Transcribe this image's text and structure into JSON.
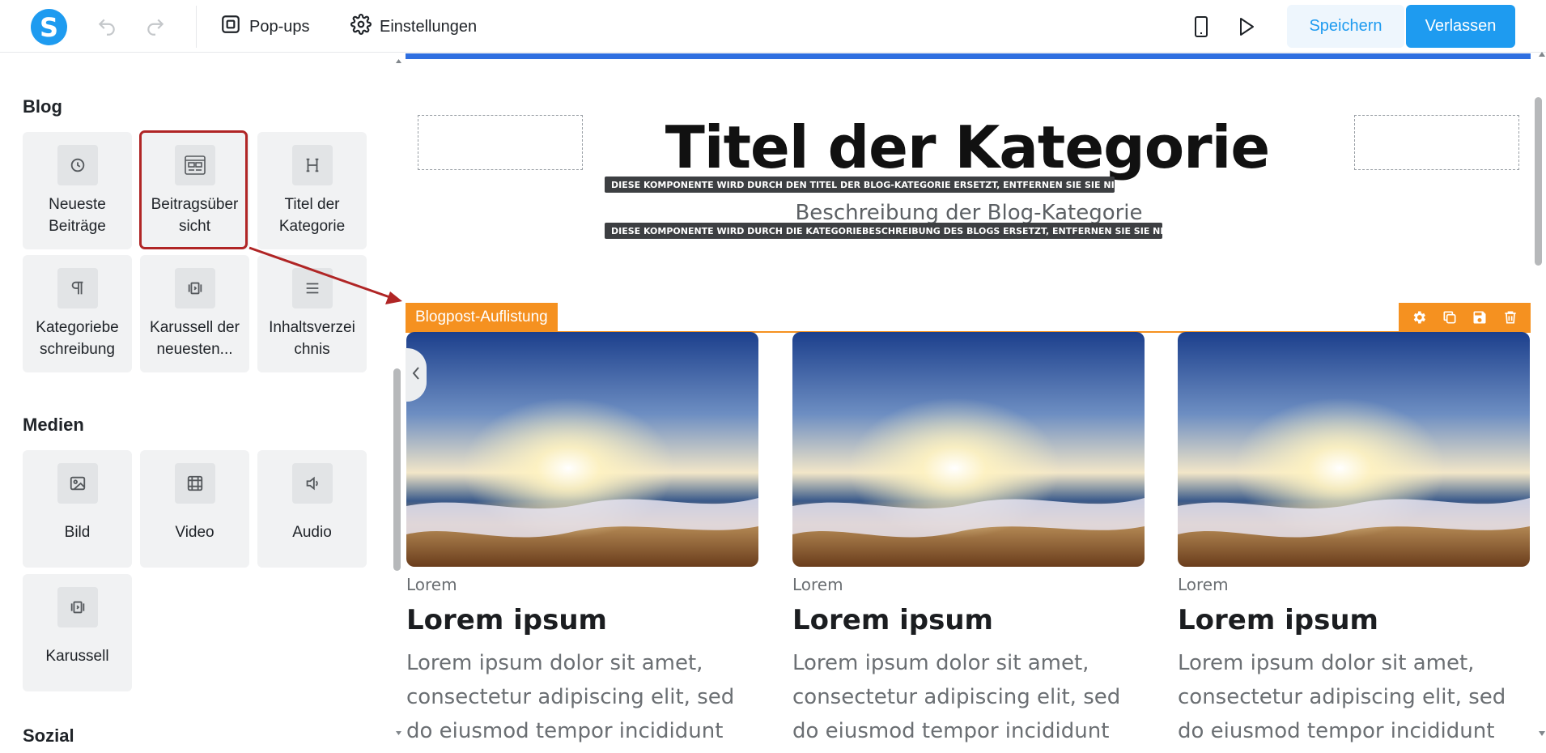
{
  "app": {
    "logo_letter": "S"
  },
  "toolbar": {
    "popups_label": "Pop-ups",
    "settings_label": "Einstellungen",
    "save_label": "Speichern",
    "exit_label": "Verlassen"
  },
  "sidebar": {
    "sections": [
      {
        "title": "Blog",
        "items": [
          {
            "label": "Neueste Beiträge",
            "icon": "clock-icon"
          },
          {
            "label": "Beitragsübersicht",
            "icon": "layout-icon"
          },
          {
            "label": "Titel der Kategorie",
            "icon": "heading-icon"
          },
          {
            "label": "Kategoriebeschreibung",
            "icon": "paragraph-icon"
          },
          {
            "label": "Karussell der neuesten...",
            "icon": "carousel-icon"
          },
          {
            "label": "Inhaltsverzeichnis",
            "icon": "list-icon"
          }
        ]
      },
      {
        "title": "Medien",
        "items": [
          {
            "label": "Bild",
            "icon": "image-icon"
          },
          {
            "label": "Video",
            "icon": "video-icon"
          },
          {
            "label": "Audio",
            "icon": "audio-icon"
          },
          {
            "label": "Karussell",
            "icon": "carousel-icon"
          }
        ]
      },
      {
        "title": "Sozial",
        "items": []
      }
    ],
    "tile_lines": {
      "t0": [
        "Neueste",
        "Beiträge"
      ],
      "t1": [
        "Beitragsüber",
        "sicht"
      ],
      "t2": [
        "Titel der",
        "Kategorie"
      ],
      "t3": [
        "Kategoriebe",
        "schreibung"
      ],
      "t4": [
        "Karussell der",
        "neuesten..."
      ],
      "t5": [
        "Inhaltsverzei",
        "chnis"
      ]
    }
  },
  "canvas": {
    "category_title": "Titel der Kategorie",
    "category_title_notice": "DIESE KOMPONENTE WIRD DURCH DEN TITEL DER BLOG-KATEGORIE ERSETZT, ENTFERNEN SIE SIE NICHT",
    "category_description": "Beschreibung der Blog-Kategorie",
    "category_description_notice": "DIESE KOMPONENTE WIRD DURCH DIE KATEGORIEBESCHREIBUNG DES BLOGS ERSETZT, ENTFERNEN SIE SIE NICHT",
    "component_label": "Blogpost-Auflistung",
    "posts": [
      {
        "category": "Lorem",
        "title": "Lorem ipsum",
        "excerpt_lines": [
          "Lorem ipsum dolor sit amet,",
          "consectetur adipiscing elit, sed",
          "do eiusmod tempor incididunt"
        ]
      },
      {
        "category": "Lorem",
        "title": "Lorem ipsum",
        "excerpt_lines": [
          "Lorem ipsum dolor sit amet,",
          "consectetur adipiscing elit, sed",
          "do eiusmod tempor incididunt"
        ]
      },
      {
        "category": "Lorem",
        "title": "Lorem ipsum",
        "excerpt_lines": [
          "Lorem ipsum dolor sit amet,",
          "consectetur adipiscing elit, sed",
          "do eiusmod tempor incididunt"
        ]
      }
    ]
  },
  "colors": {
    "brand": "#1e9bf0",
    "component_accent": "#f59120",
    "highlight": "#b02525",
    "top_bar_accent": "#2f6fe0"
  }
}
